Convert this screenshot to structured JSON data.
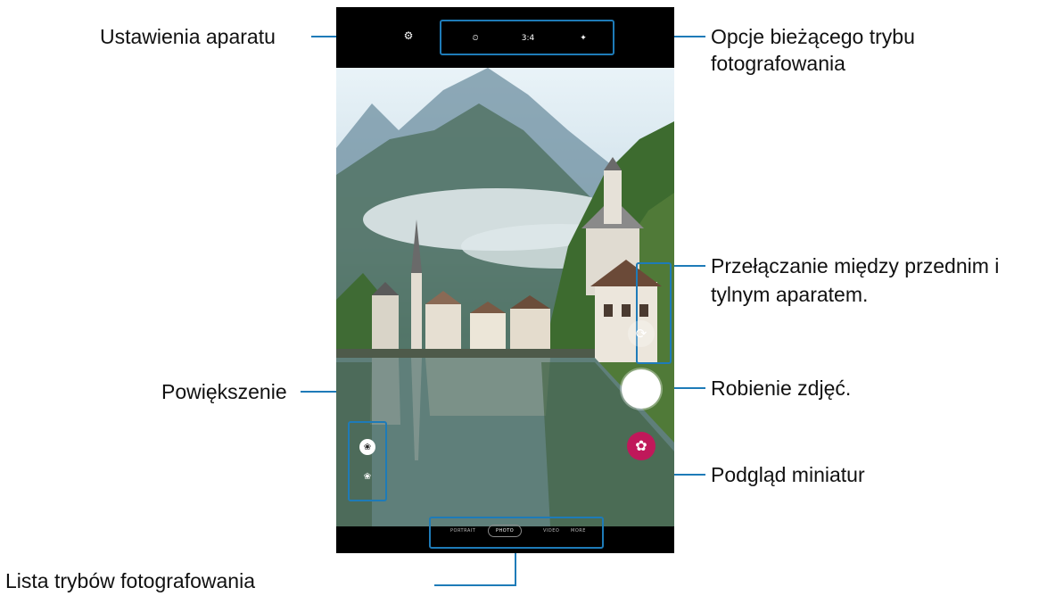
{
  "callouts": {
    "settings": "Ustawienia aparatu",
    "options_line1": "Opcje bieżącego trybu",
    "options_line2": "fotografowania",
    "switch_line1": "Przełączanie między przednim i",
    "switch_line2": "tylnym aparatem.",
    "zoom": "Powiększenie",
    "shutter": "Robienie zdjęć.",
    "preview": "Podgląd miniatur",
    "modes_list": "Lista trybów fotografowania"
  },
  "camera": {
    "quick_options": [
      {
        "icon": "timer-off-icon",
        "glyph": "⏲"
      },
      {
        "icon": "aspect-ratio-icon",
        "glyph": "3:4"
      },
      {
        "icon": "effects-icon",
        "glyph": "✦"
      }
    ],
    "modes": [
      "PORTRAIT",
      "PHOTO",
      "VIDEO",
      "MORE"
    ],
    "selected_mode": "PHOTO"
  },
  "colors": {
    "accent": "#1e7bb8",
    "thumbnail": "#c0185a"
  }
}
